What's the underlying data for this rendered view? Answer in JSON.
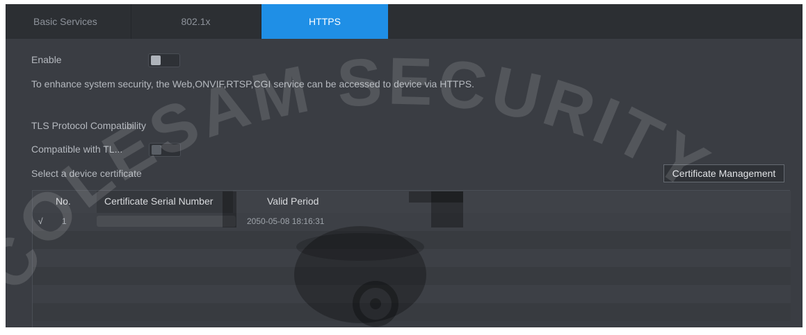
{
  "tabs": [
    {
      "label": "Basic Services",
      "active": false
    },
    {
      "label": "802.1x",
      "active": false
    },
    {
      "label": "HTTPS",
      "active": true
    }
  ],
  "enable": {
    "label": "Enable",
    "on": false
  },
  "description": "To enhance system security, the Web,ONVIF,RTSP,CGI service can be accessed to device via HTTPS.",
  "tls": {
    "section_label": "TLS Protocol Compatibility",
    "compatible_label": "Compatible with TL...",
    "compatible_on": false
  },
  "certificate": {
    "select_label": "Select a device certificate",
    "management_button": "Certificate Management",
    "columns": {
      "no": "No.",
      "serial": "Certificate Serial Number",
      "valid": "Valid Period"
    },
    "rows": [
      {
        "checked": "√",
        "no": "1",
        "serial": "",
        "valid": "2050-05-08 18:16:31"
      }
    ]
  },
  "watermark": "COLESAM SECURITY",
  "colors": {
    "accent": "#1f8fe6",
    "panel": "#3a3d43",
    "tabbar": "#2c2f33"
  }
}
